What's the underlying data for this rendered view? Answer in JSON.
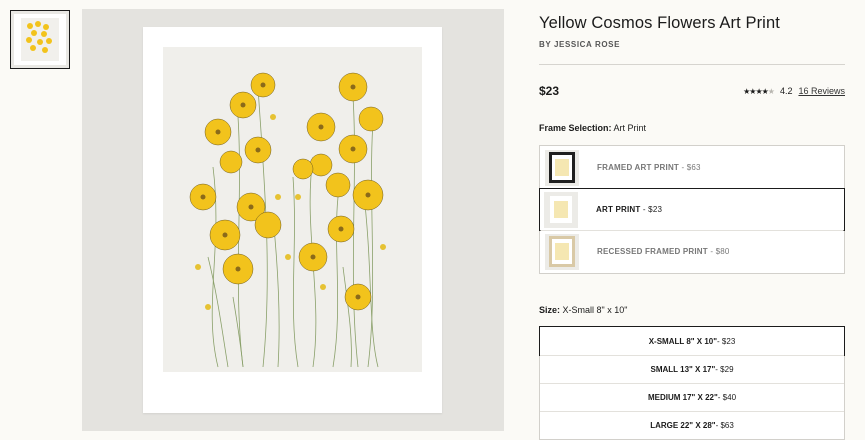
{
  "product": {
    "title": "Yellow Cosmos Flowers Art Print",
    "artist": "BY JESSICA ROSE",
    "price": "$23",
    "rating": {
      "stars": 4.2,
      "value_label": "4.2",
      "reviews_label": "16 Reviews"
    }
  },
  "frame_selection": {
    "label": "Frame Selection:",
    "current": "Art Print",
    "options": [
      {
        "name": "FRAMED ART PRINT",
        "price": " - $63",
        "selected": false,
        "thumb": "black-frame"
      },
      {
        "name": "ART PRINT",
        "price": " - $23",
        "selected": true,
        "thumb": "no-frame"
      },
      {
        "name": "RECESSED FRAMED PRINT",
        "price": " - $80",
        "selected": false,
        "thumb": "recessed-frame"
      }
    ]
  },
  "size_selection": {
    "label": "Size:",
    "current": "X-Small 8\" x 10\"",
    "options": [
      {
        "name": "X-SMALL 8\" X 10\"",
        "price": " - $23",
        "selected": true
      },
      {
        "name": "SMALL 13\" X 17\"",
        "price": " - $29",
        "selected": false
      },
      {
        "name": "MEDIUM 17\" X 22\"",
        "price": " - $40",
        "selected": false
      },
      {
        "name": "LARGE 22\" X 28\"",
        "price": " - $63",
        "selected": false
      }
    ]
  },
  "colors": {
    "accent": "#1b1b1b",
    "flower": "#f2c31c",
    "background": "#fbfaf6"
  }
}
